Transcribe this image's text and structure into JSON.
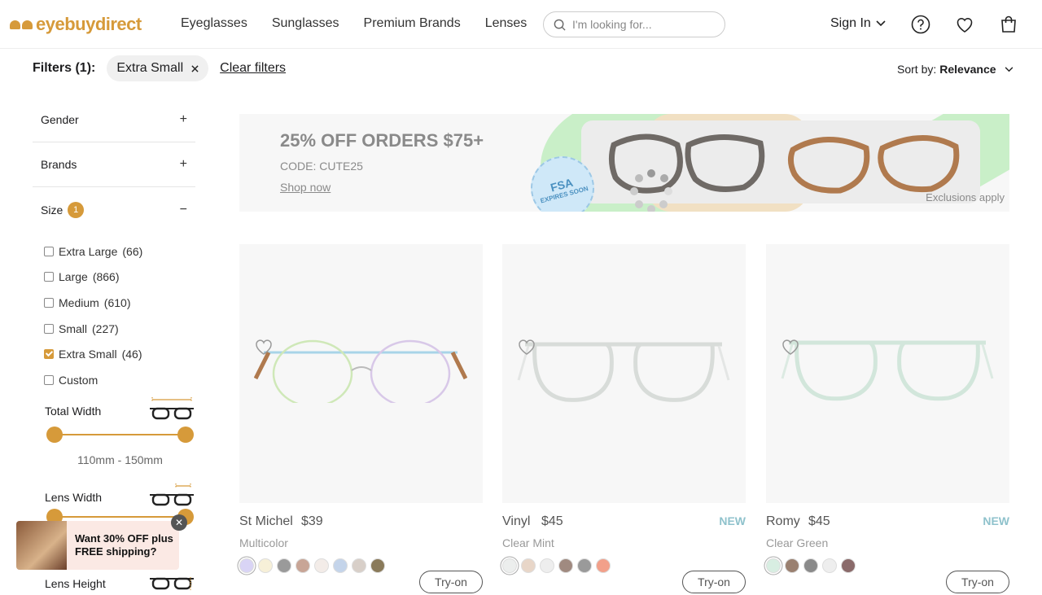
{
  "header": {
    "logo_text": "eyebuydirect",
    "nav": [
      "Eyeglasses",
      "Sunglasses",
      "Premium Brands",
      "Lenses"
    ],
    "search_placeholder": "I'm looking for...",
    "sign_in": "Sign In"
  },
  "filterbar": {
    "label": "Filters (1):",
    "chip": "Extra Small",
    "clear": "Clear filters",
    "sort_label": "Sort by:",
    "sort_value": "Relevance"
  },
  "sidebar": {
    "gender": "Gender",
    "brands": "Brands",
    "size": "Size",
    "size_badge": "1",
    "size_options": [
      {
        "label": "Extra Large",
        "count": "(66)",
        "checked": false
      },
      {
        "label": "Large",
        "count": "(866)",
        "checked": false
      },
      {
        "label": "Medium",
        "count": "(610)",
        "checked": false
      },
      {
        "label": "Small",
        "count": "(227)",
        "checked": false
      },
      {
        "label": "Extra Small",
        "count": "(46)",
        "checked": true
      },
      {
        "label": "Custom",
        "count": "",
        "checked": false
      }
    ],
    "total_width": {
      "label": "Total Width",
      "range": "110mm - 150mm"
    },
    "lens_width": {
      "label": "Lens Width"
    },
    "lens_height": {
      "label": "Lens Height"
    }
  },
  "promo_popup": {
    "line1": "Want 30% OFF plus",
    "line2": "FREE shipping?"
  },
  "banner": {
    "title": "25% OFF ORDERS $75+",
    "code": "CODE: CUTE25",
    "link": "Shop now",
    "exclusions": "Exclusions apply",
    "badge_main": "FSA",
    "badge_sub": "EXPIRES SOON"
  },
  "products": [
    {
      "name": "St Michel",
      "price": "$39",
      "new": "",
      "color": "Multicolor",
      "swatches": [
        "#d9d4f5",
        "#f7f0d8",
        "#9a9a9a",
        "#c8a596",
        "#f3ece8",
        "#c4d4ea",
        "#d8cfc8",
        "#8a7a5a"
      ],
      "try_on": "Try-on"
    },
    {
      "name": "Vinyl",
      "price": "$45",
      "new": "NEW",
      "color": "Clear Mint",
      "swatches": [
        "#eceeed",
        "#e8d6c8",
        "#eeeeee",
        "#a08a80",
        "#9a9a9a",
        "#f2a08a"
      ],
      "try_on": "Try-on"
    },
    {
      "name": "Romy",
      "price": "$45",
      "new": "NEW",
      "color": "Clear Green",
      "swatches": [
        "#d8eee2",
        "#9a8070",
        "#8a8a8a",
        "#eeeeee",
        "#8a6a6a"
      ],
      "try_on": "Try-on"
    }
  ],
  "colors": {
    "accent": "#d69a3a"
  }
}
